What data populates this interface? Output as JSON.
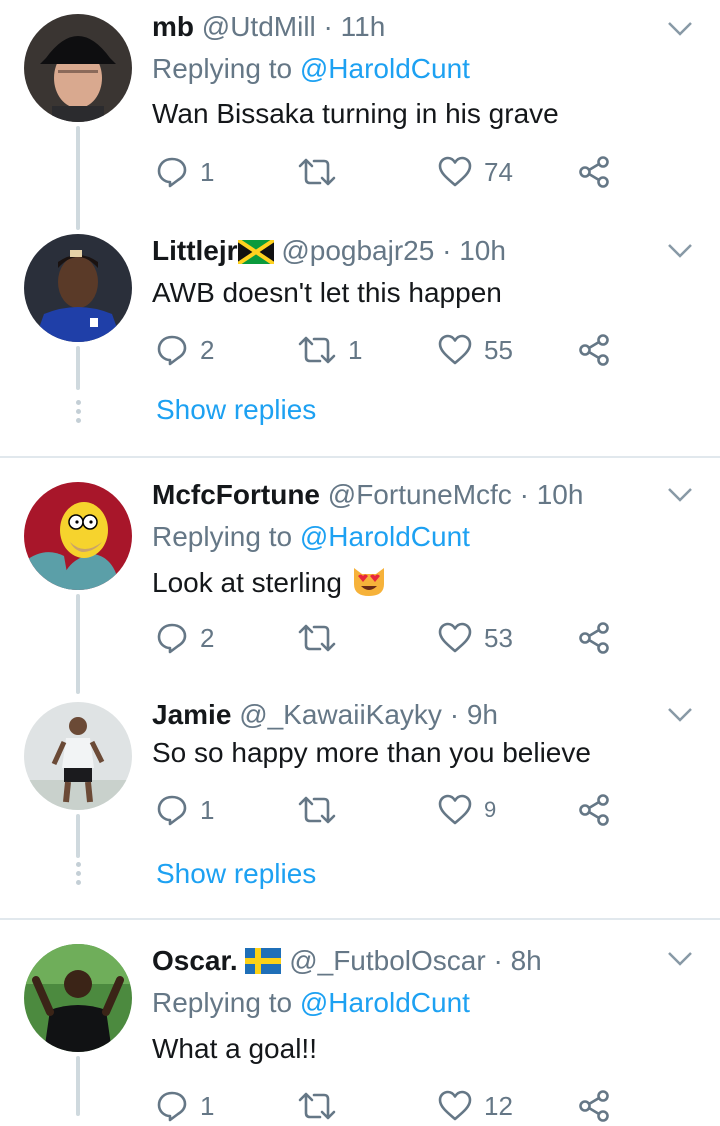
{
  "colors": {
    "link": "#1da1f2",
    "secondary": "#657786",
    "text": "#14171a",
    "divider": "#e1e8ed"
  },
  "tweets": [
    {
      "name": "mb",
      "handle": "@UtdMill",
      "time": "11h",
      "replying_prefix": "Replying to",
      "replying_handle": "@HaroldCunt",
      "text": "Wan Bissaka turning in his grave",
      "replies": "1",
      "retweets": "",
      "likes": "74"
    },
    {
      "name": "Littlejr",
      "flag_icon": "jamaica-flag-icon",
      "handle": "@pogbajr25",
      "time": "10h",
      "text": "AWB doesn't let this happen",
      "replies": "2",
      "retweets": "1",
      "likes": "55",
      "show_replies": "Show replies"
    },
    {
      "name": "McfcFortune",
      "handle": "@FortuneMcfc",
      "time": "10h",
      "replying_prefix": "Replying to",
      "replying_handle": "@HaroldCunt",
      "text": "Look at sterling",
      "emoji_icon": "heart-eyes-cat-emoji",
      "replies": "2",
      "retweets": "",
      "likes": "53"
    },
    {
      "name": "Jamie",
      "handle": "@_KawaiiKayky",
      "time": "9h",
      "text": "So so happy more than you believe",
      "replies": "1",
      "retweets": "",
      "likes": "9",
      "show_replies": "Show replies"
    },
    {
      "name": "Oscar.",
      "flag_icon": "sweden-flag-icon",
      "handle": "@_FutbolOscar",
      "time": "8h",
      "replying_prefix": "Replying to",
      "replying_handle": "@HaroldCunt",
      "text": "What a goal!!",
      "replies": "1",
      "retweets": "",
      "likes": "12"
    }
  ]
}
